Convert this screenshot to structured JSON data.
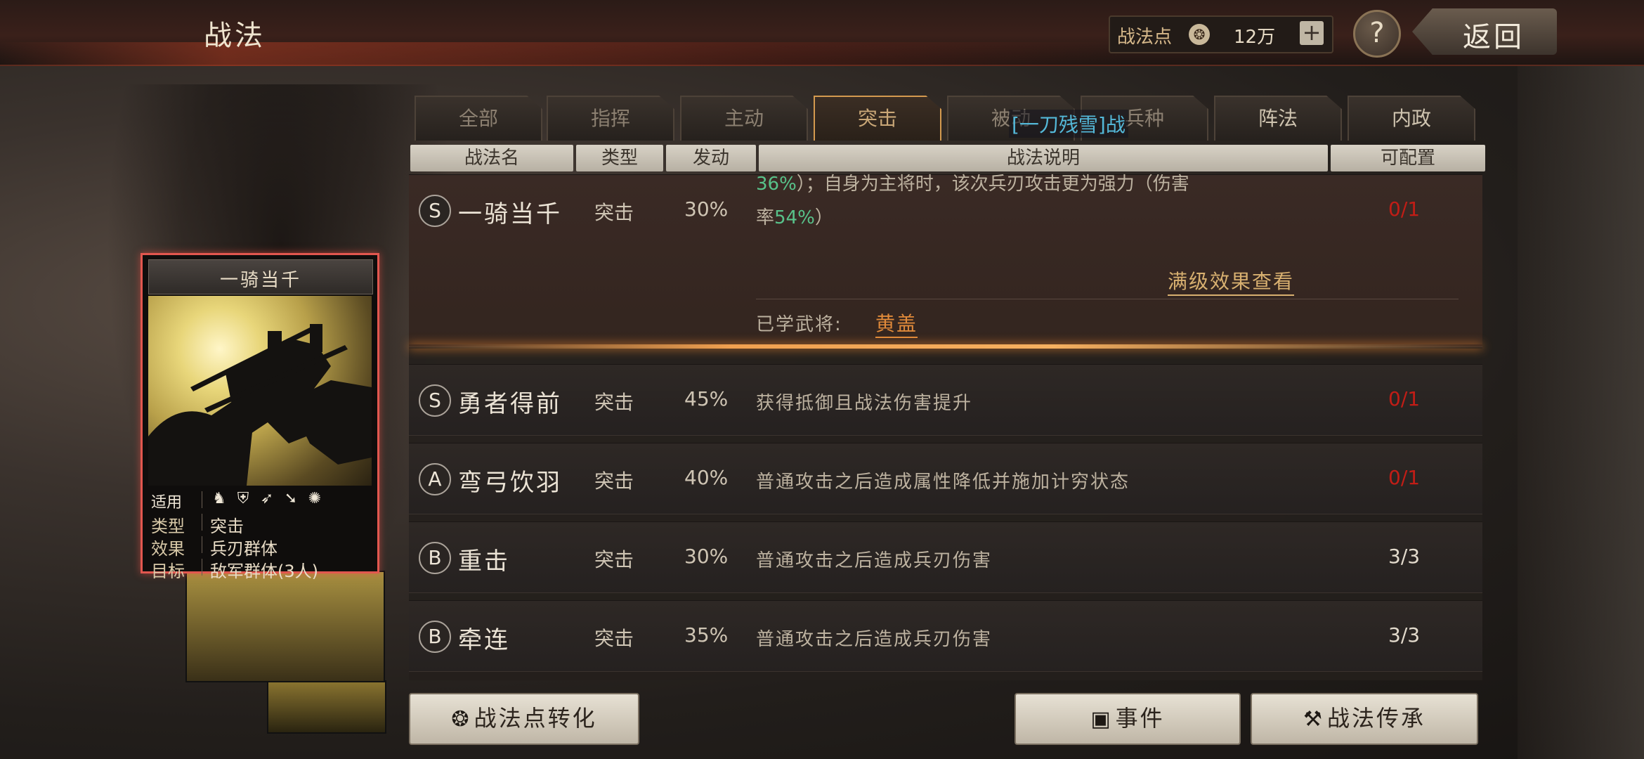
{
  "header": {
    "title": "战法",
    "points_label": "战法点",
    "points_value": "12万",
    "plus_label": "+",
    "help_label": "?",
    "back_label": "返回"
  },
  "tabs": [
    {
      "label": "全部"
    },
    {
      "label": "指挥"
    },
    {
      "label": "主动"
    },
    {
      "label": "突击"
    },
    {
      "label": "被动"
    },
    {
      "label": "兵种"
    },
    {
      "label": "阵法"
    },
    {
      "label": "内政"
    }
  ],
  "tooltip": "[一刀残雪]战",
  "columns": {
    "name": "战法名",
    "type": "类型",
    "rate": "发动",
    "desc": "战法说明",
    "config": "可配置"
  },
  "expanded": {
    "grade": "S",
    "name": "一骑当千",
    "type": "突击",
    "rate": "30%",
    "desc_line1_a": "36%",
    "desc_line1_b": "）；自身为主将时，该次兵刃攻击更为强力（伤害",
    "desc_line2_a": "率",
    "desc_line2_b": "54%",
    "desc_line2_c": "）",
    "config": "0/1",
    "max_link": "满级效果查看",
    "learned_label": "已学武将:",
    "learned_value": "黄盖"
  },
  "rows": [
    {
      "grade": "S",
      "name": "勇者得前",
      "type": "突击",
      "rate": "45%",
      "desc": "获得抵御且战法伤害提升",
      "config": "0/1"
    },
    {
      "grade": "A",
      "name": "弯弓饮羽",
      "type": "突击",
      "rate": "40%",
      "desc": "普通攻击之后造成属性降低并施加计穷状态",
      "config": "0/1"
    },
    {
      "grade": "B",
      "name": "重击",
      "type": "突击",
      "rate": "30%",
      "desc": "普通攻击之后造成兵刃伤害",
      "config": "3/3"
    },
    {
      "grade": "B",
      "name": "牵连",
      "type": "突击",
      "rate": "35%",
      "desc": "普通攻击之后造成兵刃伤害",
      "config": "3/3"
    }
  ],
  "card": {
    "title": "一骑当千",
    "k_apply": "适用",
    "k_type": "类型",
    "v_type": "突击",
    "k_effect": "效果",
    "v_effect": "兵刃群体",
    "k_target": "目标",
    "v_target": "敌军群体(3人)",
    "unit_icons": [
      "cavalry-icon",
      "shield-icon",
      "bow-icon",
      "spear-icon",
      "wheel-icon"
    ]
  },
  "buttons": {
    "convert": "战法点转化",
    "event": "事件",
    "inherit": "战法传承"
  },
  "colors": {
    "config_red": "#c11d16",
    "highlight_green": "#58c28a",
    "learned_orange": "#e08a3a",
    "card_border": "#e2574f"
  }
}
